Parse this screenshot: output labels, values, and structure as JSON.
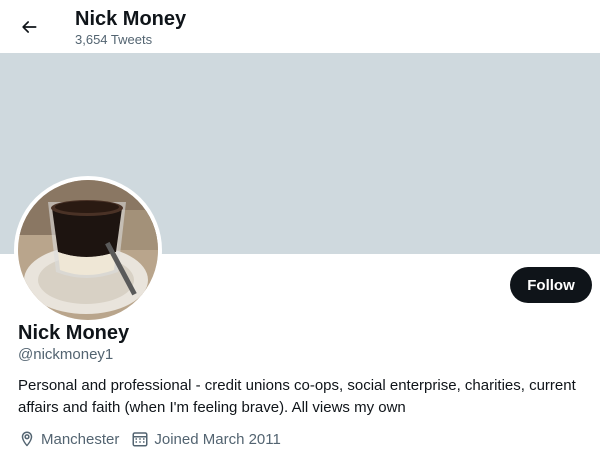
{
  "header": {
    "title": "Nick Money",
    "tweet_count": "3,654 Tweets"
  },
  "banner": {
    "color": "#cfd9de"
  },
  "profile": {
    "name": "Nick Money",
    "handle": "@nickmoney1",
    "bio": "Personal and professional - credit unions co-ops, social enterprise, charities, current affairs and faith (when I'm feeling brave). All views my own",
    "location": "Manchester",
    "joined": "Joined March 2011",
    "follow_label": "Follow"
  },
  "icons": {
    "back": "arrow-left-icon",
    "location": "location-pin-icon",
    "calendar": "calendar-icon"
  },
  "colors": {
    "text_primary": "#0f1419",
    "text_secondary": "#536471",
    "follow_bg": "#0f1419"
  }
}
